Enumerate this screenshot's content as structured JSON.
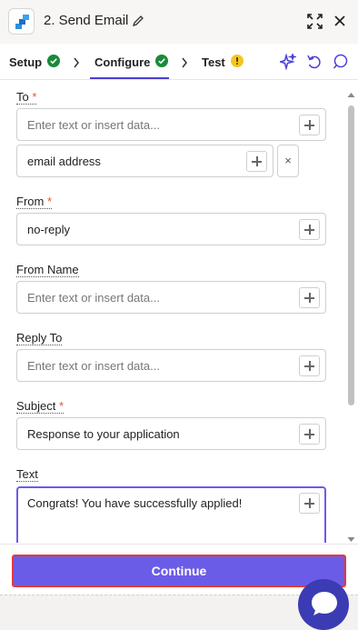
{
  "header": {
    "title": "2. Send Email",
    "accent": "#4a3fd6"
  },
  "tabs": [
    {
      "label": "Setup",
      "status": "complete"
    },
    {
      "label": "Configure",
      "status": "complete"
    },
    {
      "label": "Test",
      "status": "warning"
    }
  ],
  "fields": {
    "to": {
      "label": "To",
      "required": "*",
      "placeholder": "Enter text or insert data...",
      "value": "email address"
    },
    "from": {
      "label": "From",
      "required": "*",
      "value": "no-reply"
    },
    "from_name": {
      "label": "From Name",
      "placeholder": "Enter text or insert data..."
    },
    "reply_to": {
      "label": "Reply To",
      "placeholder": "Enter text or insert data..."
    },
    "subject": {
      "label": "Subject",
      "required": "*",
      "value": "Response to your application"
    },
    "text": {
      "label": "Text",
      "value": "Congrats! You have successfully applied!"
    }
  },
  "remove_label": "×",
  "footer": {
    "continue_label": "Continue"
  }
}
